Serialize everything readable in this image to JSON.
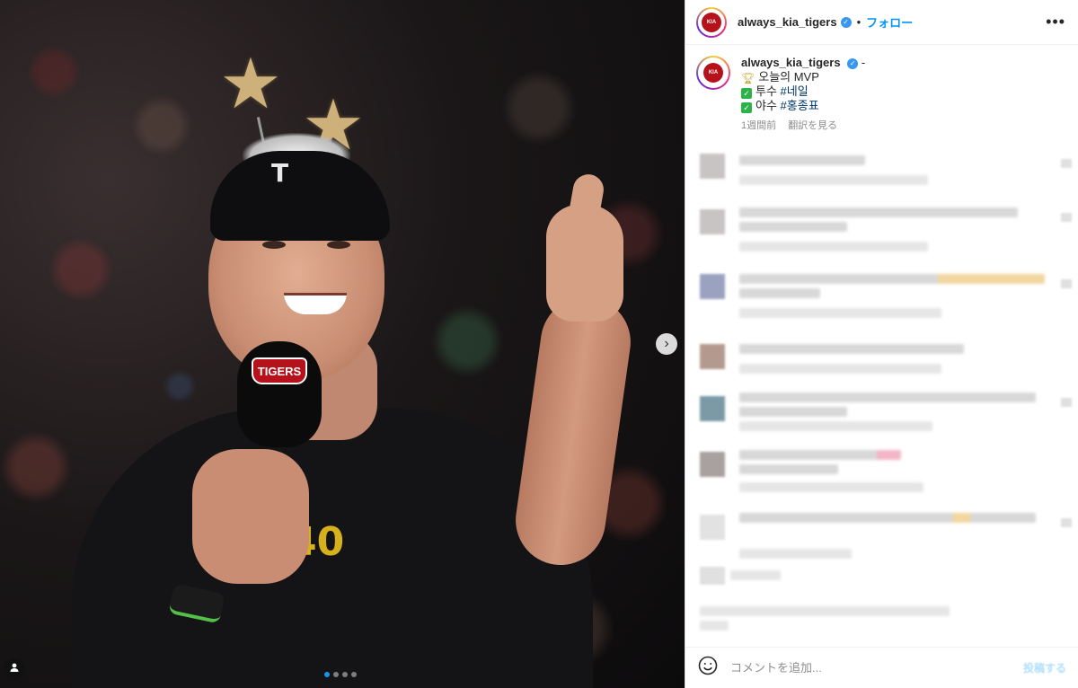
{
  "post": {
    "username": "always_kia_tigers",
    "follow_label": "フォロー",
    "separator": "•",
    "more_icon": "•••",
    "caption": {
      "username": "always_kia_tigers",
      "suffix": "-",
      "line1": "오늘의 MVP",
      "line2_prefix": "투수",
      "line2_tag": "#네일",
      "line3_prefix": "야수",
      "line3_tag": "#홍종표"
    },
    "time_ago": "1週間前",
    "translate_label": "翻訳を見る"
  },
  "photo": {
    "mic_badge": "TIGERS",
    "jersey_number": "40",
    "cap_letter": "T",
    "carousel_count": 4,
    "carousel_active": 1
  },
  "footer": {
    "comment_placeholder": "コメントを追加...",
    "post_label": "投稿する"
  },
  "icons": [
    "chevron-right-icon",
    "user-tag-icon",
    "verified-badge-icon",
    "more-icon",
    "smile-icon",
    "trophy-icon",
    "checkbox-icon"
  ],
  "colors": {
    "accent": "#0095f6",
    "verified": "#3897f0",
    "hashtag": "#00376b",
    "check": "#2bb34a"
  }
}
